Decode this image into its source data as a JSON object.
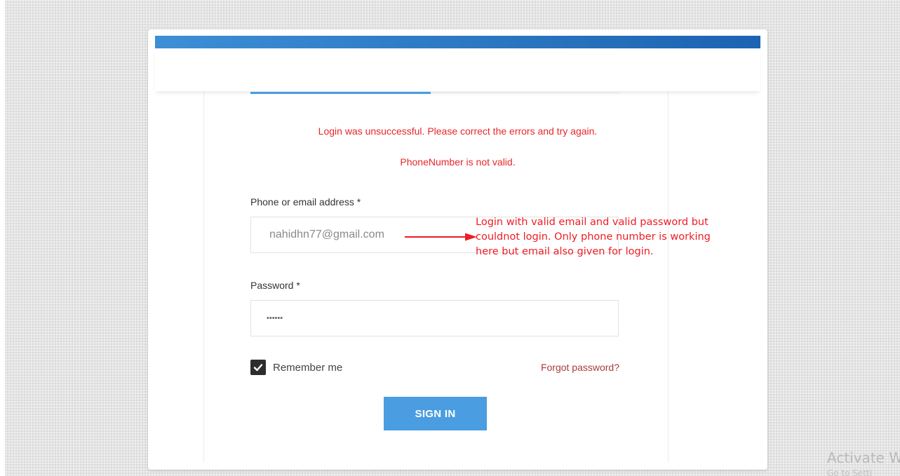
{
  "login": {
    "errors": {
      "summary": "Login was unsuccessful. Please correct the errors and try again.",
      "phone": "PhoneNumber is not valid."
    },
    "identifier": {
      "label": "Phone or email address *",
      "value": "nahidhn77@gmail.com"
    },
    "password": {
      "label": "Password *",
      "value": "••••••"
    },
    "remember": {
      "label": "Remember me",
      "checked": true
    },
    "forgot_link": "Forgot password?",
    "submit_label": "SIGN IN"
  },
  "annotation": {
    "lines": [
      "Login with valid email and valid password but",
      "couldnot login. Only phone number is working",
      "here but email also given for login."
    ],
    "color": "#ef1c25"
  },
  "watermark": {
    "title": "Activate W",
    "subtitle": "Go to Setti"
  },
  "colors": {
    "accent": "#4a9de0",
    "header": "#1c63b1",
    "error": "#e8262a"
  }
}
